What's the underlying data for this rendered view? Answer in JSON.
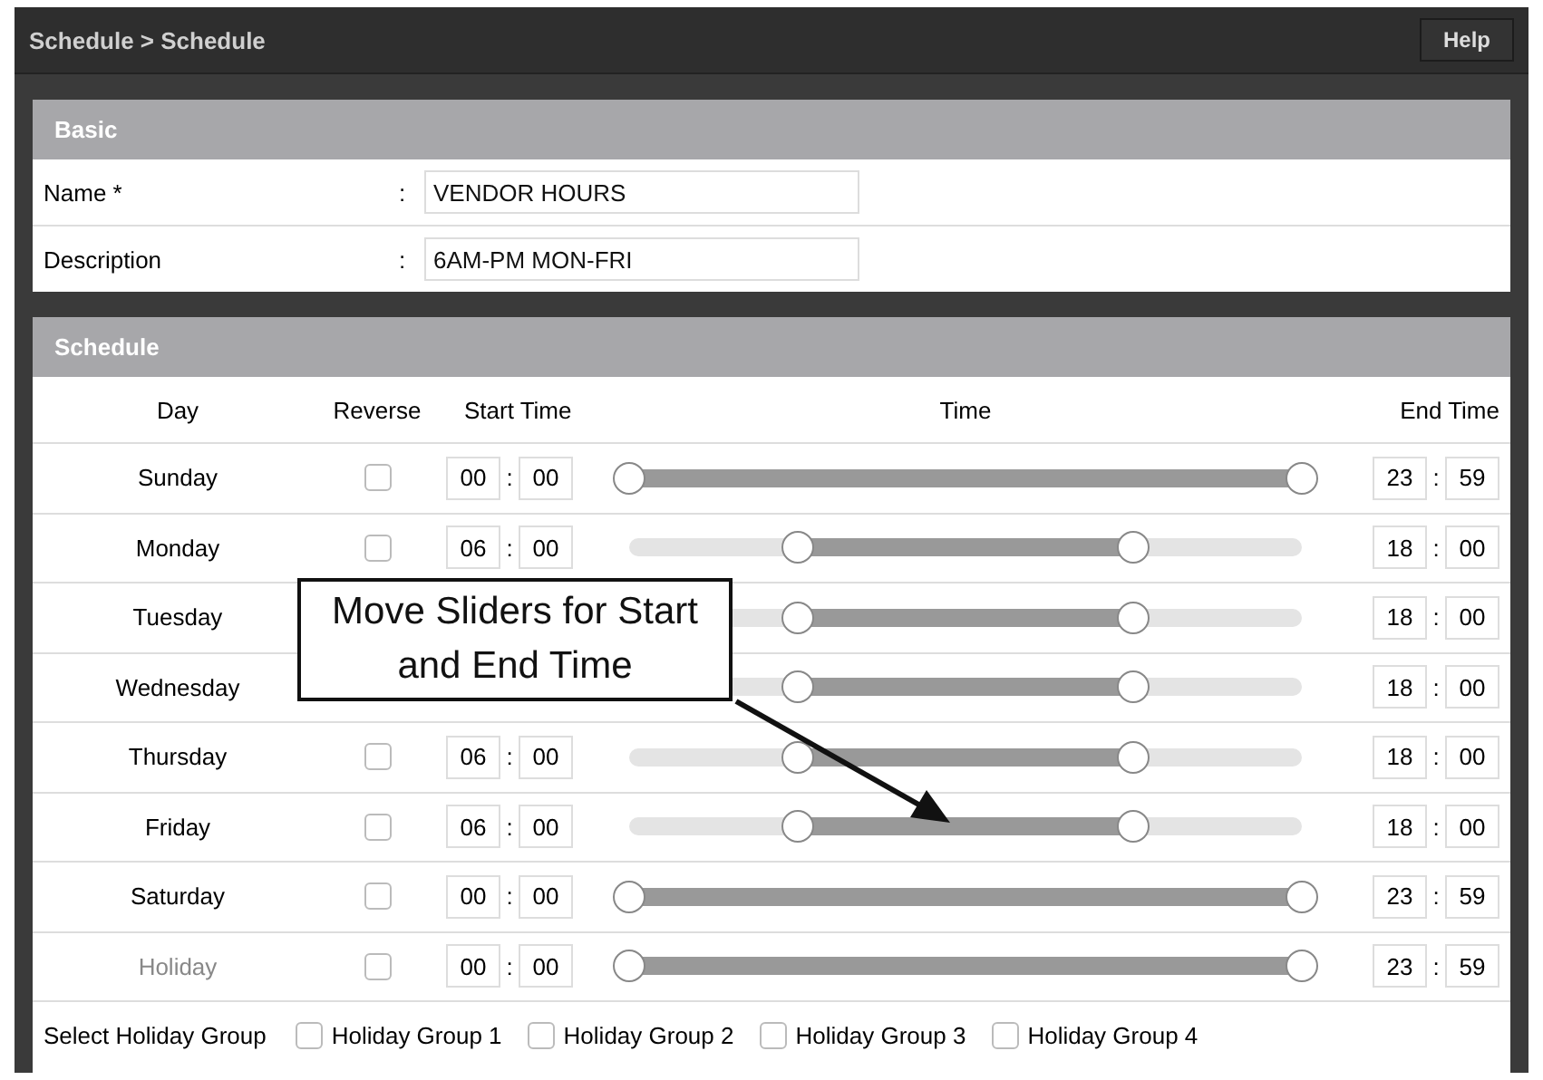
{
  "header": {
    "breadcrumb": "Schedule > Schedule",
    "help_button": "Help"
  },
  "basic": {
    "title": "Basic",
    "fields": [
      {
        "label": "Name *",
        "separator": ":",
        "value": "VENDOR HOURS"
      },
      {
        "label": "Description",
        "separator": ":",
        "value": "6AM-PM MON-FRI"
      }
    ]
  },
  "schedule": {
    "title": "Schedule",
    "columns": [
      "Day",
      "Reverse",
      "Start Time",
      "Time",
      "End Time"
    ],
    "rows": [
      {
        "day": "Sunday",
        "dimmed": false,
        "reverse": false,
        "start": [
          "00",
          "00"
        ],
        "end": [
          "23",
          "59"
        ],
        "handles": [
          {
            "level": 0
          },
          {
            "level": 1
          }
        ]
      },
      {
        "day": "Monday",
        "dimmed": false,
        "reverse": false,
        "start": [
          "06",
          "00"
        ],
        "end": [
          "18",
          "00"
        ],
        "handles": [
          {
            "level": 0.25
          },
          {
            "level": 0.75
          }
        ]
      },
      {
        "day": "Tuesday",
        "dimmed": false,
        "start": [],
        "end": [
          "18",
          "00"
        ],
        "handles": [
          {
            "level": 0.25
          },
          {
            "level": 0.75
          }
        ]
      },
      {
        "day": "Wednesday",
        "dimmed": false,
        "start": [],
        "end": [
          "18",
          "00"
        ],
        "handles": [
          {
            "level": 0.25
          },
          {
            "level": 0.75
          }
        ]
      },
      {
        "day": "Thursday",
        "dimmed": false,
        "reverse": false,
        "start": [
          "06",
          "00"
        ],
        "end": [
          "18",
          "00"
        ],
        "handles": [
          {
            "level": 0.25
          },
          {
            "level": 0.75
          }
        ]
      },
      {
        "day": "Friday",
        "dimmed": false,
        "reverse": false,
        "start": [
          "06",
          "00"
        ],
        "end": [
          "18",
          "00"
        ],
        "handles": [
          {
            "level": 0.25
          },
          {
            "level": 0.75
          }
        ]
      },
      {
        "day": "Saturday",
        "dimmed": false,
        "reverse": false,
        "start": [
          "00",
          "00"
        ],
        "end": [
          "23",
          "59"
        ],
        "handles": [
          {
            "level": 0
          },
          {
            "level": 1
          }
        ]
      },
      {
        "day": "Holiday",
        "dimmed": true,
        "reverse": false,
        "start": [
          "00",
          "00"
        ],
        "end": [
          "23",
          "59"
        ],
        "handles": [
          {
            "level": 0
          },
          {
            "level": 1
          }
        ]
      }
    ],
    "time_separator": ":",
    "holiday_group": {
      "label": "Select Holiday Group",
      "options": [
        {
          "label": "Holiday Group 1",
          "checked": false
        },
        {
          "label": "Holiday Group 2",
          "checked": false
        },
        {
          "label": "Holiday Group 3",
          "checked": false
        },
        {
          "label": "Holiday Group 4",
          "checked": false
        }
      ]
    }
  },
  "callout": {
    "text": "Move Sliders for Start and End Time"
  }
}
